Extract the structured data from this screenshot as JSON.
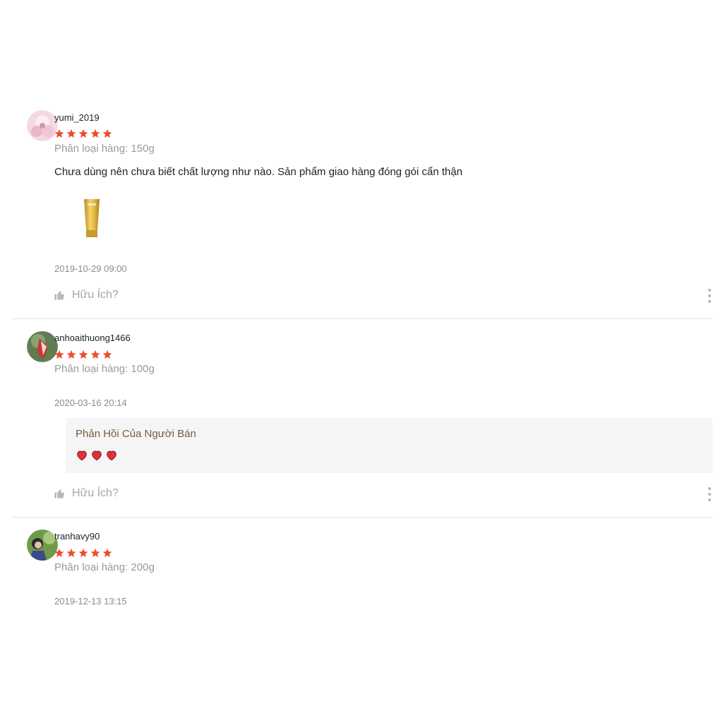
{
  "reviews": [
    {
      "username": "yumi_2019",
      "rating": 5,
      "variation": "Phân loại hàng: 150g",
      "comment": "Chưa dùng nên chưa biết chất lượng như nào. Sản phẩm giao hàng đóng gói cẩn thận",
      "date": "2019-10-29 09:00",
      "helpful_label": "Hữu Ích?"
    },
    {
      "username": "anhoaithuong1466",
      "rating": 5,
      "variation": "Phân loại hàng: 100g",
      "date": "2020-03-16 20:14",
      "seller_reply": {
        "title": "Phản Hồi Của Người Bán",
        "hearts": 3
      },
      "helpful_label": "Hữu Ích?"
    },
    {
      "username": "tranhavy90",
      "rating": 5,
      "variation": "Phân loại hàng: 200g",
      "date": "2019-12-13 13:15"
    }
  ],
  "colors": {
    "star": "#ee4d2d",
    "heart": "#e0303b",
    "seller_title": "#7a5b3a",
    "muted": "#9a9a9a"
  },
  "icons": {
    "star": "star-icon",
    "thumb": "thumbs-up-icon",
    "more": "more-vertical-icon",
    "heart": "heart-icon"
  }
}
